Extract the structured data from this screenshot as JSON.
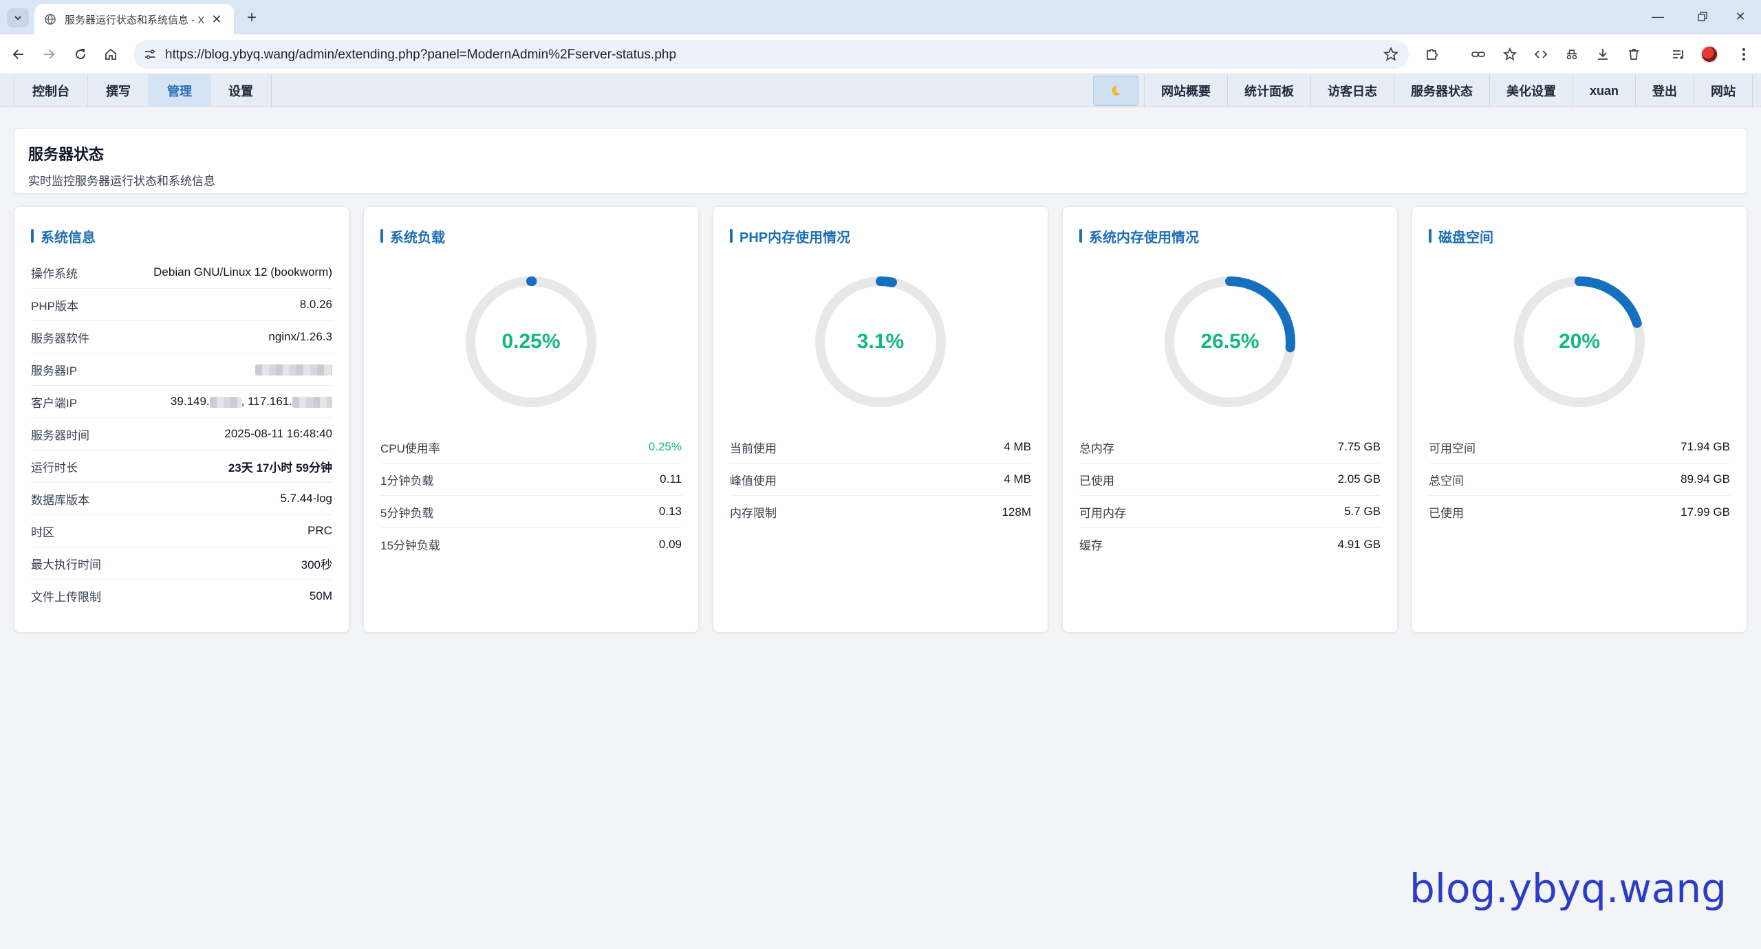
{
  "browser": {
    "tab_title": "服务器运行状态和系统信息 - X",
    "url": "https://blog.ybyq.wang/admin/extending.php?panel=ModernAdmin%2Fserver-status.php"
  },
  "admin_nav": {
    "left": [
      "控制台",
      "撰写",
      "管理",
      "设置"
    ],
    "active": "管理",
    "right": [
      "网站概要",
      "统计面板",
      "访客日志",
      "服务器状态",
      "美化设置",
      "xuan",
      "登出",
      "网站"
    ]
  },
  "header": {
    "title": "服务器状态",
    "subtitle": "实时监控服务器运行状态和系统信息"
  },
  "system_info": {
    "title": "系统信息",
    "rows": [
      {
        "k": "操作系统",
        "v": "Debian GNU/Linux 12 (bookworm)"
      },
      {
        "k": "PHP版本",
        "v": "8.0.26"
      },
      {
        "k": "服务器软件",
        "v": "nginx/1.26.3"
      },
      {
        "k": "服务器IP",
        "v": ""
      },
      {
        "k": "客户端IP",
        "v_a": "39.149.",
        "v_b": ", 117.161."
      },
      {
        "k": "服务器时间",
        "v": "2025-08-11 16:48:40"
      },
      {
        "k": "运行时长",
        "v": "23天 17小时 59分钟"
      },
      {
        "k": "数据库版本",
        "v": "5.7.44-log"
      },
      {
        "k": "时区",
        "v": "PRC"
      },
      {
        "k": "最大执行时间",
        "v": "300秒"
      },
      {
        "k": "文件上传限制",
        "v": "50M"
      }
    ]
  },
  "load": {
    "title": "系统负载",
    "percent_label": "0.25%",
    "percent": 0.25,
    "rows": [
      {
        "k": "CPU使用率",
        "v": "0.25%"
      },
      {
        "k": "1分钟负载",
        "v": "0.11"
      },
      {
        "k": "5分钟负载",
        "v": "0.13"
      },
      {
        "k": "15分钟负载",
        "v": "0.09"
      }
    ]
  },
  "php_mem": {
    "title": "PHP内存使用情况",
    "percent_label": "3.1%",
    "percent": 3.1,
    "rows": [
      {
        "k": "当前使用",
        "v": "4 MB"
      },
      {
        "k": "峰值使用",
        "v": "4 MB"
      },
      {
        "k": "内存限制",
        "v": "128M"
      }
    ]
  },
  "sys_mem": {
    "title": "系统内存使用情况",
    "percent_label": "26.5%",
    "percent": 26.5,
    "rows": [
      {
        "k": "总内存",
        "v": "7.75 GB"
      },
      {
        "k": "已使用",
        "v": "2.05 GB"
      },
      {
        "k": "可用内存",
        "v": "5.7 GB"
      },
      {
        "k": "缓存",
        "v": "4.91 GB"
      }
    ]
  },
  "disk": {
    "title": "磁盘空间",
    "percent_label": "20%",
    "percent": 20,
    "rows": [
      {
        "k": "可用空间",
        "v": "71.94 GB"
      },
      {
        "k": "总空间",
        "v": "89.94 GB"
      },
      {
        "k": "已使用",
        "v": "17.99 GB"
      }
    ]
  },
  "colors": {
    "accent": "#1f6fb5",
    "gauge_track": "#e8e8e8",
    "gauge_value": "#1670c0",
    "percent_text": "#10b981"
  },
  "watermark": "blog.ybyq.wang"
}
